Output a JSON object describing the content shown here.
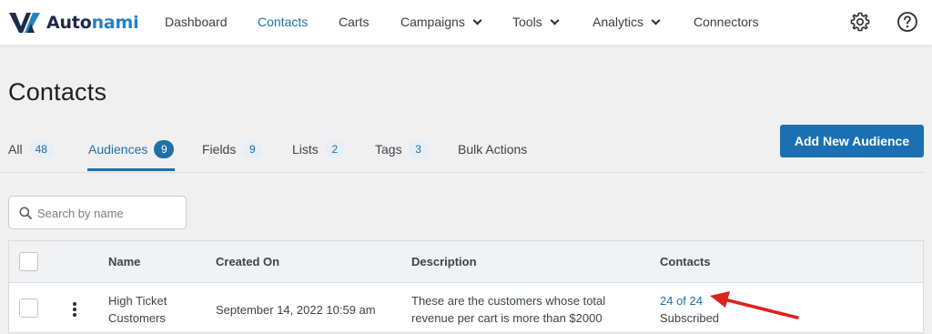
{
  "brand": {
    "name_part1": "Auto",
    "name_part2": "nami",
    "accent_color": "#1f6fa8",
    "dark_color": "#1d2a4d"
  },
  "nav": {
    "items": [
      {
        "label": "Dashboard",
        "active": false,
        "has_dropdown": false
      },
      {
        "label": "Contacts",
        "active": true,
        "has_dropdown": false
      },
      {
        "label": "Carts",
        "active": false,
        "has_dropdown": false
      },
      {
        "label": "Campaigns",
        "active": false,
        "has_dropdown": true
      },
      {
        "label": "Tools",
        "active": false,
        "has_dropdown": true
      },
      {
        "label": "Analytics",
        "active": false,
        "has_dropdown": true
      },
      {
        "label": "Connectors",
        "active": false,
        "has_dropdown": false
      }
    ],
    "settings_icon": "gear-icon",
    "help_icon": "help-circle-icon"
  },
  "page": {
    "title": "Contacts"
  },
  "tabs": [
    {
      "label": "All",
      "count": "48",
      "active": false
    },
    {
      "label": "Audiences",
      "count": "9",
      "active": true
    },
    {
      "label": "Fields",
      "count": "9",
      "active": false
    },
    {
      "label": "Lists",
      "count": "2",
      "active": false
    },
    {
      "label": "Tags",
      "count": "3",
      "active": false
    },
    {
      "label": "Bulk Actions",
      "count": null,
      "active": false
    }
  ],
  "actions": {
    "add_label": "Add New Audience"
  },
  "search": {
    "placeholder": "Search by name",
    "value": ""
  },
  "table": {
    "columns": [
      "Name",
      "Created On",
      "Description",
      "Contacts"
    ],
    "rows": [
      {
        "name_line1": "High Ticket",
        "name_line2": "Customers",
        "created_on": "September 14, 2022 10:59 am",
        "description_line1": "These are the customers whose total",
        "description_line2": "revenue per cart is more than $2000",
        "contacts_count": "24 of 24",
        "contacts_status": "Subscribed"
      }
    ]
  },
  "annotation": {
    "arrow_color": "#e0201e"
  }
}
